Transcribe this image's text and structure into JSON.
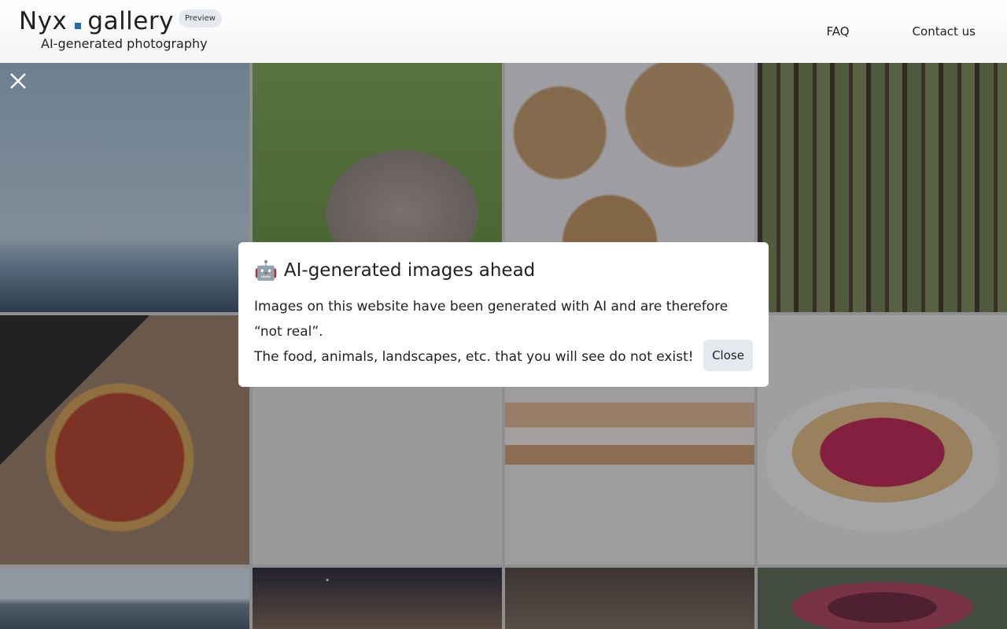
{
  "header": {
    "logo_left": "Nyx",
    "logo_right": "gallery",
    "badge": "Preview",
    "tagline": "AI-generated photography",
    "nav": [
      {
        "label": "FAQ"
      },
      {
        "label": "Contact us"
      }
    ]
  },
  "gallery": {
    "tiles": [
      {
        "subject": "mountains"
      },
      {
        "subject": "rabbit"
      },
      {
        "subject": "cookies"
      },
      {
        "subject": "forest"
      },
      {
        "subject": "pizza"
      },
      {
        "subject": "blank"
      },
      {
        "subject": "cake"
      },
      {
        "subject": "tart"
      },
      {
        "subject": "alps"
      },
      {
        "subject": "stars"
      },
      {
        "subject": "brown"
      },
      {
        "subject": "fig"
      }
    ],
    "close_icon": "close-icon"
  },
  "modal": {
    "emoji": "🤖",
    "title": "AI-generated images ahead",
    "line1": "Images on this website have been generated with AI and are therefore “not real”.",
    "line2": "The food, animals, landscapes, etc. that you will see do not exist!",
    "close_label": "Close"
  },
  "colors": {
    "accent": "#1e6fa8",
    "badge_bg": "#e6e9ee",
    "button_bg": "#e5e8ee"
  }
}
